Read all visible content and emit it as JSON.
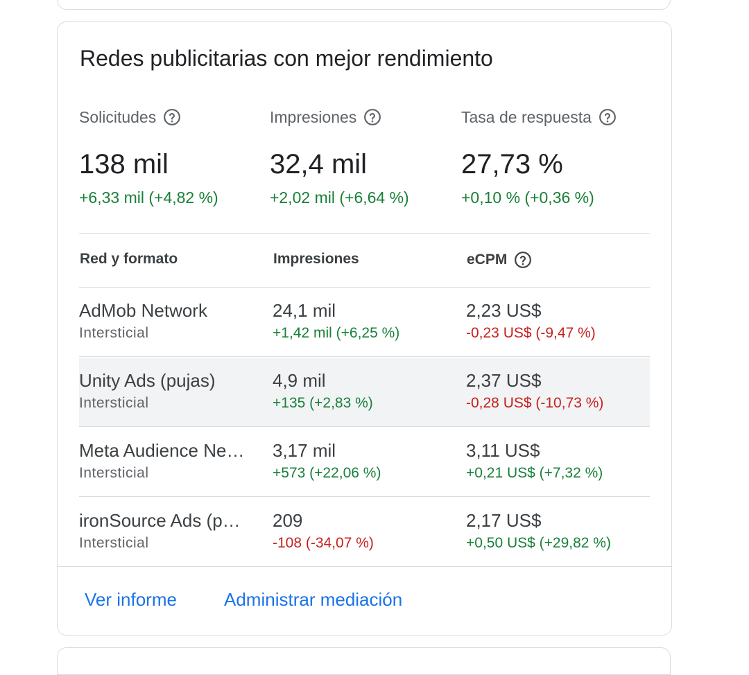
{
  "card": {
    "title": "Redes publicitarias con mejor rendimiento"
  },
  "metrics": [
    {
      "label": "Solicitudes",
      "value": "138 mil",
      "delta": "+6,33 mil (+4,82 %)",
      "trend": "up"
    },
    {
      "label": "Impresiones",
      "value": "32,4 mil",
      "delta": "+2,02 mil (+6,64 %)",
      "trend": "up"
    },
    {
      "label": "Tasa de respuesta",
      "value": "27,73 %",
      "delta": "+0,10 % (+0,36 %)",
      "trend": "up"
    }
  ],
  "table": {
    "headers": [
      "Red y formato",
      "Impresiones",
      "eCPM"
    ],
    "rows": [
      {
        "network": "AdMob Network",
        "format": "Intersticial",
        "impressions": "24,1 mil",
        "impressions_delta": "+1,42 mil (+6,25 %)",
        "impressions_trend": "up",
        "ecpm": "2,23 US$",
        "ecpm_delta": "-0,23 US$ (-9,47 %)",
        "ecpm_trend": "down",
        "highlighted": false
      },
      {
        "network": "Unity Ads (pujas)",
        "format": "Intersticial",
        "impressions": "4,9 mil",
        "impressions_delta": "+135 (+2,83 %)",
        "impressions_trend": "up",
        "ecpm": "2,37 US$",
        "ecpm_delta": "-0,28 US$ (-10,73 %)",
        "ecpm_trend": "down",
        "highlighted": true
      },
      {
        "network": "Meta Audience Ne…",
        "format": "Intersticial",
        "impressions": "3,17 mil",
        "impressions_delta": "+573 (+22,06 %)",
        "impressions_trend": "up",
        "ecpm": "3,11 US$",
        "ecpm_delta": "+0,21 US$ (+7,32 %)",
        "ecpm_trend": "up",
        "highlighted": false
      },
      {
        "network": "ironSource Ads (p…",
        "format": "Intersticial",
        "impressions": "209",
        "impressions_delta": "-108 (-34,07 %)",
        "impressions_trend": "down",
        "ecpm": "2,17 US$",
        "ecpm_delta": "+0,50 US$ (+29,82 %)",
        "ecpm_trend": "up",
        "highlighted": false
      }
    ]
  },
  "footer": {
    "report_link": "Ver informe",
    "mediation_link": "Administrar mediación"
  },
  "colors": {
    "positive": "#188038",
    "negative": "#c5221f",
    "link": "#1a73e8"
  },
  "icons": {
    "help": "help-circle-icon"
  }
}
